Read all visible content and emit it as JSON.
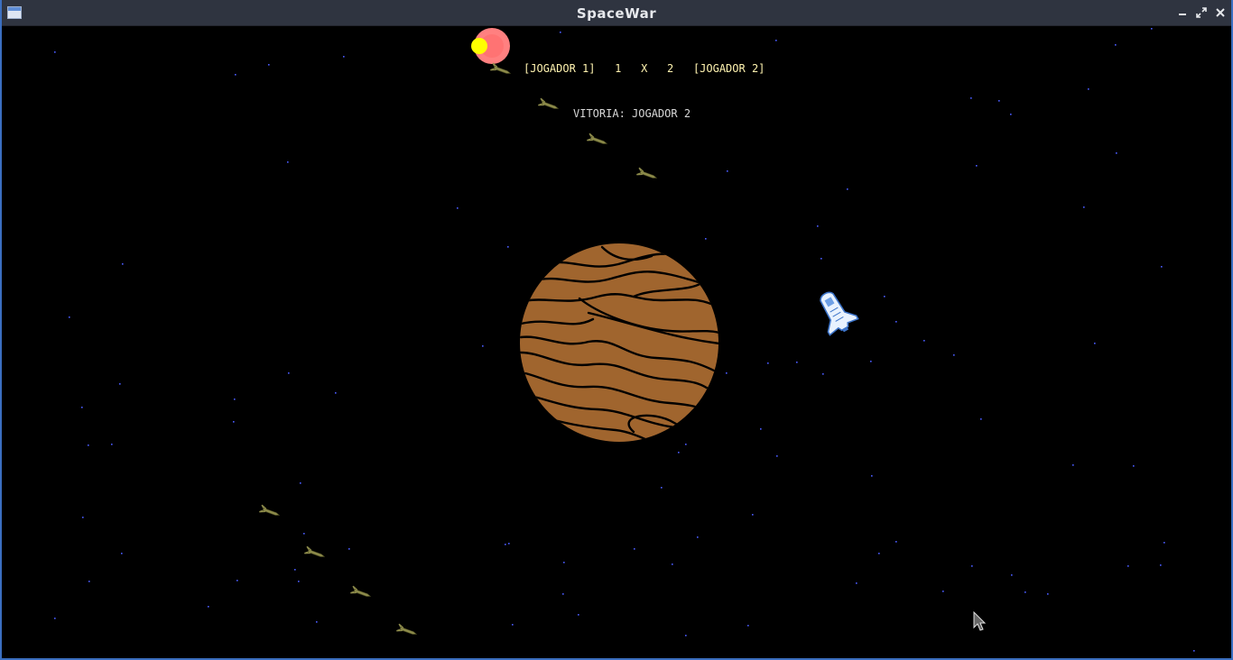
{
  "window": {
    "title": "SpaceWar",
    "controls": [
      "minimize-icon",
      "maximize-icon",
      "close-icon"
    ]
  },
  "hud": {
    "player1_label": "[JOGADOR 1]",
    "player1_score": "1",
    "separator": "X",
    "player2_score": "2",
    "player2_label": "[JOGADOR 2]",
    "victory_text": "VITORIA: JOGADOR 2"
  },
  "colors": {
    "background": "#000000",
    "titlebar": "#2f3440",
    "stars": "#4a5cff",
    "planet": "#a0652e",
    "planet_outline": "#000000",
    "sun_core": "#ffff00",
    "sun_glow": "#ff7a7a",
    "missile": "#8c8a4a",
    "score_text": "#fff3b0"
  },
  "scene": {
    "planet": "jupiter-like-planet",
    "ship": "space-shuttle",
    "sun": "sun",
    "missile_trails": 2,
    "missiles_per_trail": 4
  }
}
